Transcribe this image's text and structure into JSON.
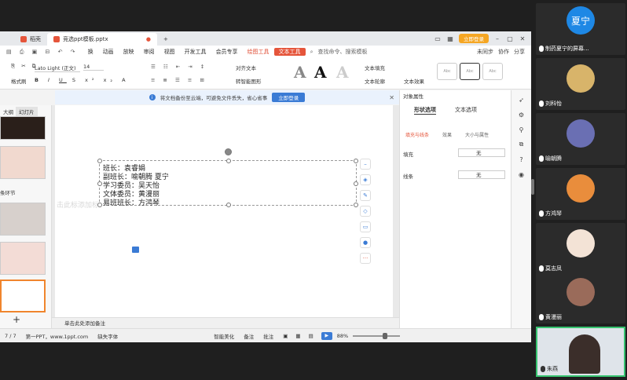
{
  "tabs": {
    "home": "稻壳",
    "doc": "竞选ppt模板.pptx",
    "add": "+",
    "login": "立即登录"
  },
  "menu": {
    "items": [
      "换",
      "动画",
      "放映",
      "审阅",
      "视图",
      "开发工具",
      "会员专享"
    ],
    "drawing_tools": "绘图工具",
    "text_tools": "文本工具",
    "search": "查找命令、搜索模板",
    "unsync": "未同步",
    "collab": "协作",
    "share": "分享"
  },
  "ribbon": {
    "format_painter": "格式刷",
    "font_name": "Lato Light (正文)",
    "font_size": "14",
    "text_align": "对齐文本",
    "smartart": "转智能图形",
    "text_fill": "文本填充",
    "text_outline": "文本轮廓",
    "text_effect": "文本效果",
    "style_sample": "Abc",
    "big_a": "A"
  },
  "info_bar": {
    "message": "将文档备份至云端，可避免文件丢失，省心省事",
    "button": "立即登录"
  },
  "left_pane": {
    "tab_outline": "大纲",
    "tab_slides": "幻灯片",
    "section_label": "条环节",
    "add": "+"
  },
  "slide": {
    "lines": [
      "班长：袁睿娟",
      "副班长：喻朝腾   夏宁",
      "学习委员：吴天怡",
      "文体委员：黄漫丽",
      "易班班长：方鸿琴"
    ],
    "ghost_text": "击此标添加标"
  },
  "notes": {
    "placeholder": "单击此处添加备注"
  },
  "right_pane": {
    "title": "对象属性",
    "tab_shape": "形状选项",
    "tab_text": "文本选项",
    "sub_fill": "填充与线条",
    "sub_effect": "效果",
    "sub_size": "大小与属性",
    "fill_label": "填充",
    "line_label": "线条",
    "fill_value": "无",
    "line_value": "无"
  },
  "status": {
    "page": "7 / 7",
    "theme": "第一PPT，www.1ppt.com",
    "missing_font": "缺失字体",
    "beautify": "智能美化",
    "notes": "备注",
    "comments": "批注",
    "zoom": "88%"
  },
  "participants": [
    {
      "name": "制药夏宁的屏幕...",
      "avatar": "夏宁",
      "color": "#1e88e5"
    },
    {
      "name": "刘科怡",
      "avatar": "",
      "color": "#d8b46a"
    },
    {
      "name": "喻朝腾",
      "avatar": "",
      "color": "#6a6fb3"
    },
    {
      "name": "方鸿琴",
      "avatar": "",
      "color": "#e98d3c"
    },
    {
      "name": "莫志凤",
      "avatar": "",
      "color": "#f3e3d6"
    },
    {
      "name": "黄漫丽",
      "avatar": "",
      "color": "#9a6b5a"
    },
    {
      "name": "朱燕",
      "avatar": "",
      "color": "#cfd6de"
    }
  ]
}
